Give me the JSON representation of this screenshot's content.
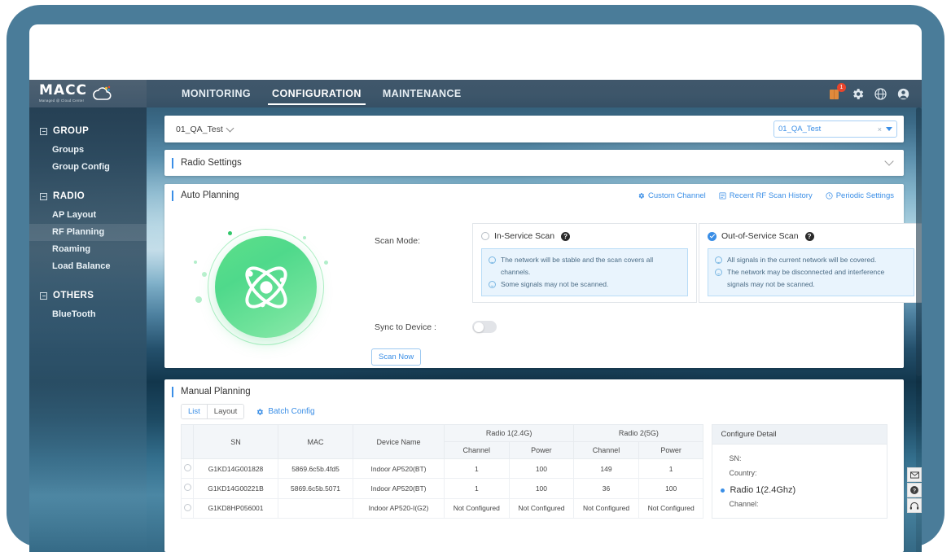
{
  "brand": {
    "name": "MACC",
    "tagline": "Managed @ Cloud Center"
  },
  "topnav": {
    "items": [
      {
        "label": "MONITORING",
        "active": false
      },
      {
        "label": "CONFIGURATION",
        "active": true
      },
      {
        "label": "MAINTENANCE",
        "active": false
      }
    ],
    "icons": [
      {
        "name": "alerts-icon",
        "badge": "1"
      },
      {
        "name": "gear-icon",
        "badge": ""
      },
      {
        "name": "globe-icon",
        "badge": ""
      },
      {
        "name": "user-icon",
        "badge": ""
      }
    ]
  },
  "sidebar": {
    "sections": [
      {
        "title": "GROUP",
        "items": [
          {
            "label": "Groups",
            "active": false
          },
          {
            "label": "Group Config",
            "active": false
          }
        ]
      },
      {
        "title": "RADIO",
        "items": [
          {
            "label": "AP Layout",
            "active": false
          },
          {
            "label": "RF Planning",
            "active": true
          },
          {
            "label": "Roaming",
            "active": false
          },
          {
            "label": "Load Balance",
            "active": false
          }
        ]
      },
      {
        "title": "OTHERS",
        "items": [
          {
            "label": "BlueTooth",
            "active": false
          }
        ]
      }
    ]
  },
  "group_bar": {
    "group_name": "01_QA_Test",
    "tag_value": "01_QA_Test",
    "clear_label": "×"
  },
  "radio_settings": {
    "title": "Radio Settings"
  },
  "auto_planning": {
    "title": "Auto Planning",
    "links": [
      {
        "label": "Custom Channel",
        "icon": "gear-icon"
      },
      {
        "label": "Recent RF Scan History",
        "icon": "history-icon"
      },
      {
        "label": "Periodic Settings",
        "icon": "clock-icon"
      }
    ],
    "scan_mode_label": "Scan Mode:",
    "options": [
      {
        "label": "In-Service Scan",
        "selected": false,
        "notes": [
          "The network will be stable and the scan covers all channels.",
          "Some signals may not be scanned."
        ]
      },
      {
        "label": "Out-of-Service Scan",
        "selected": true,
        "notes": [
          "All signals in the current network will be covered.",
          "The network may be disconnected and interference signals may not be scanned."
        ]
      }
    ],
    "sync_label": "Sync to Device :",
    "sync_on": false,
    "scan_button": "Scan Now"
  },
  "manual_planning": {
    "title": "Manual Planning",
    "view_tabs": [
      {
        "label": "List",
        "active": true
      },
      {
        "label": "Layout",
        "active": false
      }
    ],
    "batch_config": "Batch Config",
    "table": {
      "group_headers": [
        {
          "label": "Radio 1(2.4G)"
        },
        {
          "label": "Radio 2(5G)"
        }
      ],
      "columns": [
        "SN",
        "MAC",
        "Device Name",
        "Channel",
        "Power",
        "Channel",
        "Power"
      ],
      "rows": [
        {
          "sn": "G1KD14G001828",
          "mac": "5869.6c5b.4fd5",
          "device_name": "Indoor AP520(BT)",
          "r1_channel": "1",
          "r1_power": "100",
          "r2_channel": "149",
          "r2_power": "1"
        },
        {
          "sn": "G1KD14G00221B",
          "mac": "5869.6c5b.5071",
          "device_name": "Indoor AP520(BT)",
          "r1_channel": "1",
          "r1_power": "100",
          "r2_channel": "36",
          "r2_power": "100"
        },
        {
          "sn": "G1KD8HP056001",
          "mac": "",
          "device_name": "Indoor AP520-I(G2)",
          "r1_channel": "Not Configured",
          "r1_power": "Not Configured",
          "r2_channel": "Not Configured",
          "r2_power": "Not Configured"
        }
      ]
    },
    "detail": {
      "title": "Configure Detail",
      "fields": [
        {
          "label": "SN:"
        },
        {
          "label": "Country:"
        }
      ],
      "section": "Radio 1(2.4Ghz)",
      "section_field": "Channel:"
    }
  },
  "float_buttons": [
    {
      "name": "mail-icon",
      "glyph": "✉"
    },
    {
      "name": "help-icon",
      "glyph": "?"
    },
    {
      "name": "headset-icon",
      "glyph": "☎"
    }
  ],
  "colors": {
    "accent": "#3a8ee6",
    "nav_bg": "#3d566a",
    "frame": "#4a7c99",
    "atom_green": "#5ee08a",
    "badge_red": "#e8452c"
  }
}
